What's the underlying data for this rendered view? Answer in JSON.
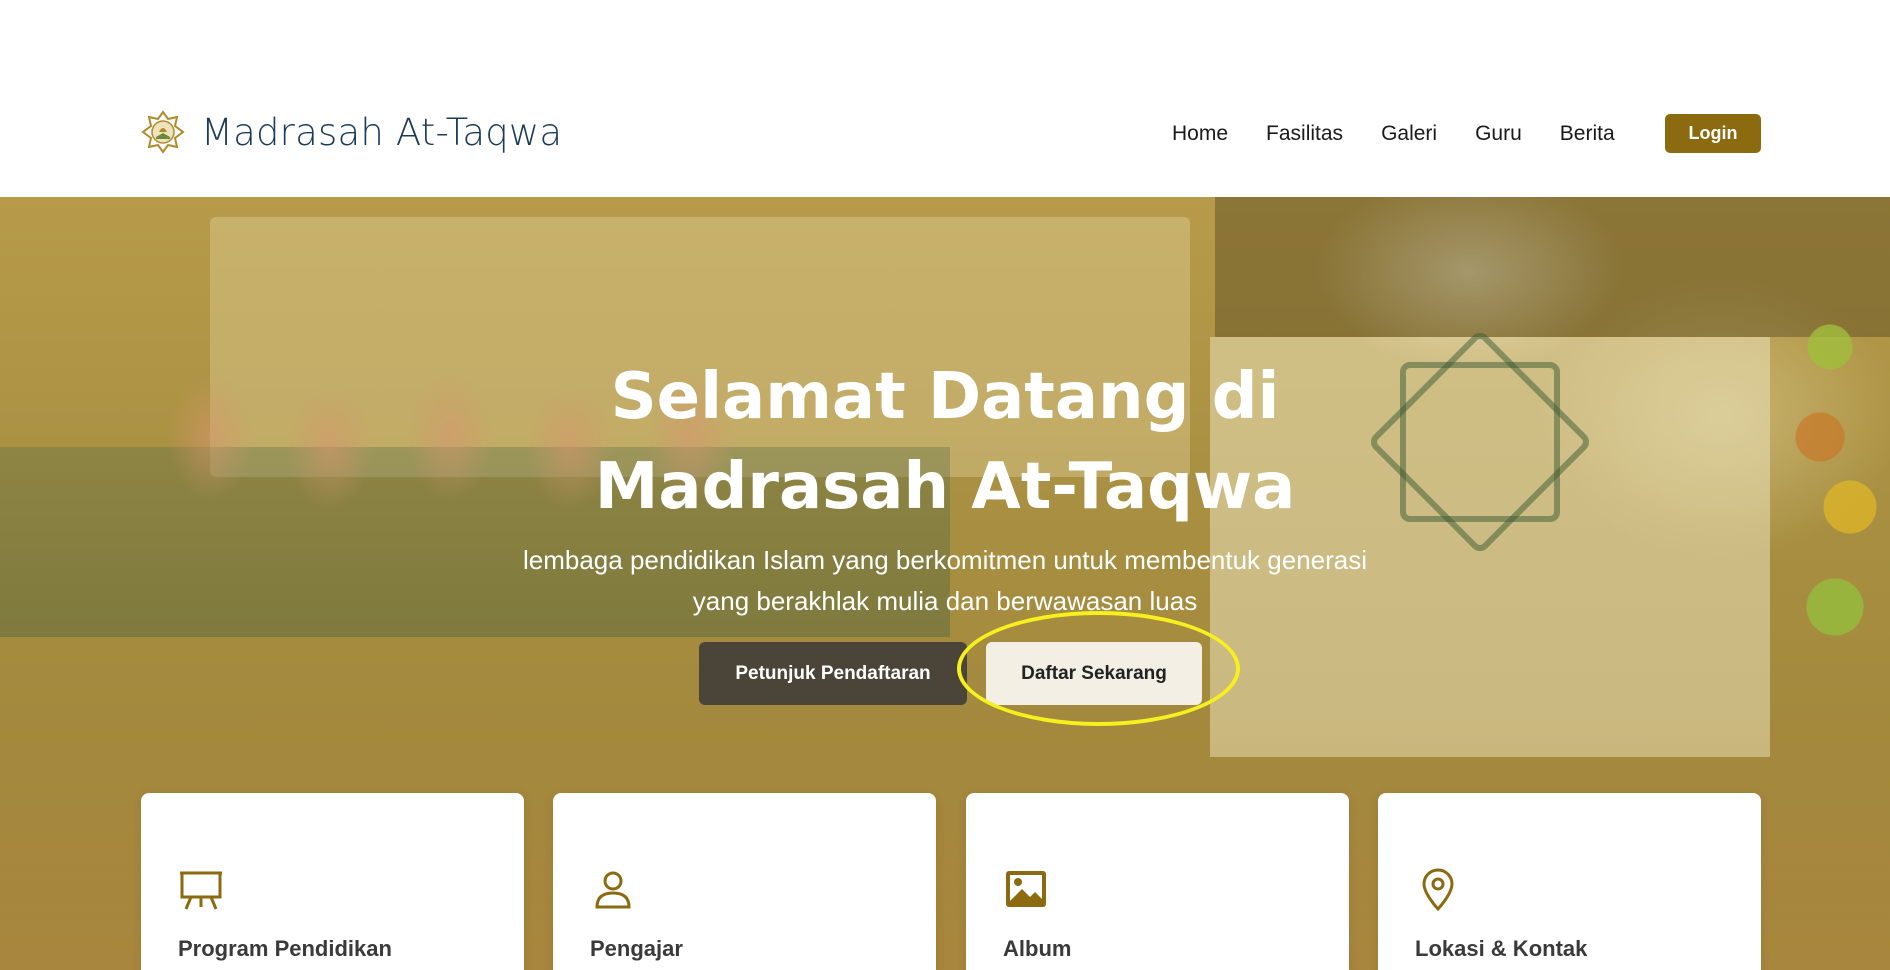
{
  "brand": {
    "name": "Madrasah At-Taqwa",
    "logo_icon": "mosque-emblem-icon"
  },
  "nav": {
    "items": [
      {
        "label": "Home"
      },
      {
        "label": "Fasilitas"
      },
      {
        "label": "Galeri"
      },
      {
        "label": "Guru"
      },
      {
        "label": "Berita"
      }
    ],
    "login_label": "Login"
  },
  "hero": {
    "title_line1": "Selamat Datang di",
    "title_line2": "Madrasah At-Taqwa",
    "subtitle_line1": "lembaga pendidikan Islam yang berkomitmen untuk membentuk generasi",
    "subtitle_line2": "yang berakhlak mulia dan berwawasan luas",
    "btn_petunjuk": "Petunjuk Pendaftaran",
    "btn_daftar": "Daftar Sekarang"
  },
  "cards": [
    {
      "title": "Program Pendidikan",
      "icon": "presentation-board-icon"
    },
    {
      "title": "Pengajar",
      "icon": "user-icon"
    },
    {
      "title": "Album",
      "icon": "image-icon"
    },
    {
      "title": "Lokasi & Kontak",
      "icon": "map-pin-icon"
    }
  ],
  "colors": {
    "accent": "#8b6a10",
    "brand_text": "#1c3b57",
    "highlight": "#f5f01e",
    "dark_button": "#4b4438",
    "light_button": "#f3efe4"
  }
}
